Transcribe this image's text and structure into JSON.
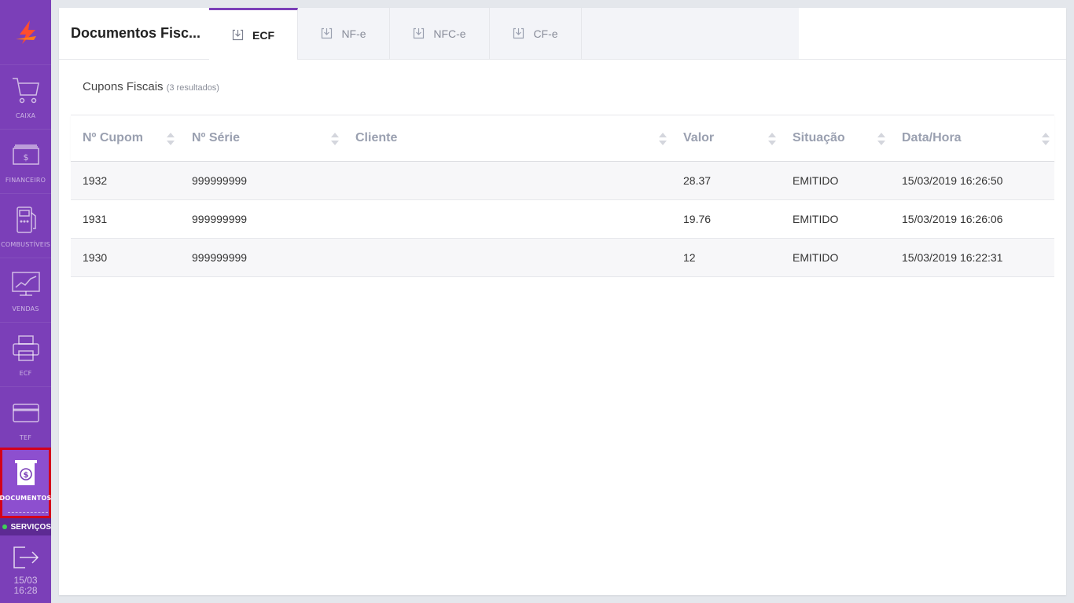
{
  "sidebar": {
    "items": [
      {
        "label": "CAIXA"
      },
      {
        "label": "FINANCEIRO"
      },
      {
        "label": "COMBUSTÍVEIS"
      },
      {
        "label": "VENDAS"
      },
      {
        "label": "ECF"
      },
      {
        "label": "TEF"
      },
      {
        "label": "DOCUMENTOS"
      }
    ],
    "servicos": "SERVIÇOS",
    "clock_date": "15/03",
    "clock_time": "16:28"
  },
  "header": {
    "title": "Documentos Fisc...",
    "tabs": [
      {
        "label": "ECF"
      },
      {
        "label": "NF-e"
      },
      {
        "label": "NFC-e"
      },
      {
        "label": "CF-e"
      }
    ]
  },
  "section": {
    "title": "Cupons Fiscais",
    "count": "(3 resultados)"
  },
  "table": {
    "columns": [
      "Nº Cupom",
      "Nº Série",
      "Cliente",
      "Valor",
      "Situação",
      "Data/Hora"
    ],
    "rows": [
      {
        "cupom": "1932",
        "serie": "999999999",
        "cliente": "",
        "valor": "28.37",
        "situacao": "EMITIDO",
        "data": "15/03/2019 16:26:50"
      },
      {
        "cupom": "1931",
        "serie": "999999999",
        "cliente": "",
        "valor": "19.76",
        "situacao": "EMITIDO",
        "data": "15/03/2019 16:26:06"
      },
      {
        "cupom": "1930",
        "serie": "999999999",
        "cliente": "",
        "valor": "12",
        "situacao": "EMITIDO",
        "data": "15/03/2019 16:22:31"
      }
    ]
  },
  "colors": {
    "sidebar": "#7b3fb8",
    "accent": "#7b3fb8",
    "highlight": "#d4001a"
  }
}
